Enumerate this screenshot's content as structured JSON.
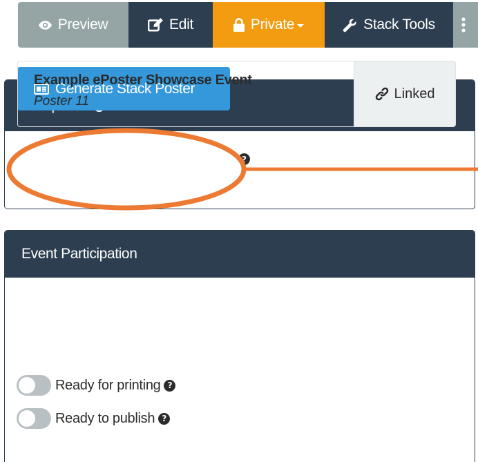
{
  "toolbar": {
    "preview_label": "Preview",
    "edit_label": "Edit",
    "private_label": "Private",
    "stack_tools_label": "Stack Tools"
  },
  "mini_poster": {
    "title": "Mini-poster",
    "generate_label": "Generate Stack Poster"
  },
  "event_participation": {
    "title": "Event Participation",
    "event_name": "Example ePoster Showcase Event",
    "poster_label": "Poster 11",
    "linked_label": "Linked",
    "toggles": [
      {
        "label": "Ready for printing"
      },
      {
        "label": "Ready to publish"
      }
    ]
  },
  "colors": {
    "dark_navy": "#2c3e50",
    "gray": "#95a5a6",
    "orange_accent": "#f39c12",
    "button_blue": "#3498db",
    "annotation_orange": "#ec7a32"
  },
  "icons": {
    "preview": "eye-icon",
    "edit": "edit-icon",
    "private": "lock-icon",
    "stack_tools": "wrench-icon",
    "more": "vertical-dots-icon",
    "generate": "poster-card-icon",
    "linked": "link-icon",
    "help": "question-circle-icon"
  }
}
